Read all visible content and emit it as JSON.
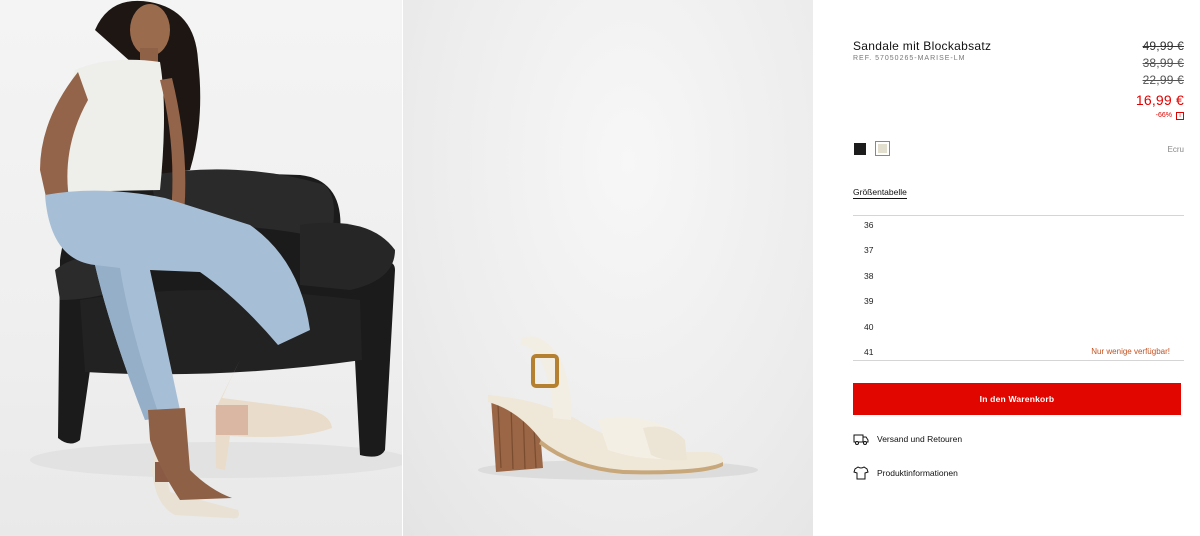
{
  "product": {
    "title": "Sandale mit Blockabsatz",
    "reference": "REF. 57050265-MARISE-LM"
  },
  "pricing": {
    "previous_prices": [
      "49,99 €",
      "38,99 €",
      "22,99 €"
    ],
    "current_price": "16,99 €",
    "discount": "-66%",
    "info_glyph": "i"
  },
  "colors": {
    "swatches": [
      {
        "name": "black",
        "hex": "#1c1c1c"
      },
      {
        "name": "ecru",
        "hex": "#e3dfce",
        "selected": true
      }
    ],
    "selected_label": "Ecru"
  },
  "size_guide_label": "Größentabelle",
  "sizes": [
    {
      "label": "36",
      "note": ""
    },
    {
      "label": "37",
      "note": ""
    },
    {
      "label": "38",
      "note": ""
    },
    {
      "label": "39",
      "note": ""
    },
    {
      "label": "40",
      "note": ""
    },
    {
      "label": "41",
      "note": "Nur wenige verfügbar!"
    }
  ],
  "actions": {
    "add_to_cart": "In den Warenkorb",
    "shipping_returns": "Versand und Retouren",
    "product_info": "Produktinformationen"
  },
  "theme": {
    "accent": "#e10600",
    "sale_red": "#e00000",
    "low_stock": "#c4511f"
  },
  "icons": {
    "shipping": "truck-icon",
    "product_info": "shirt-icon"
  }
}
